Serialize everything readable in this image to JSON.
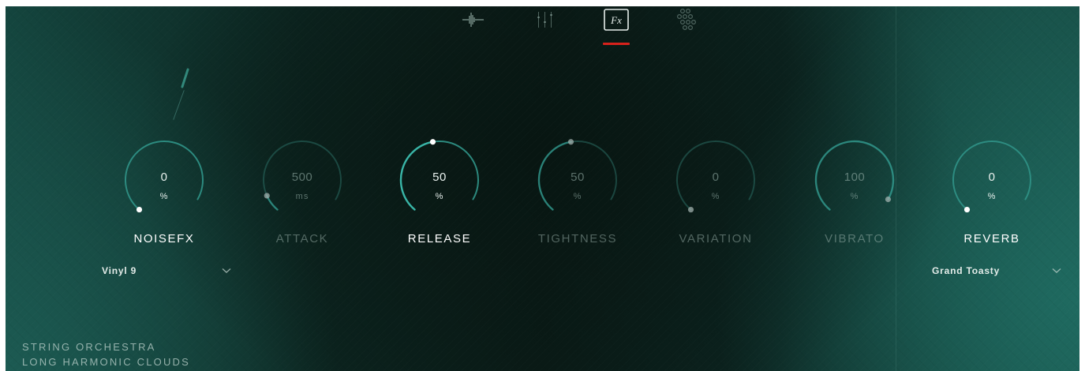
{
  "nav": {
    "tabs": [
      {
        "id": "waveform",
        "icon": "waveform-icon",
        "active": false
      },
      {
        "id": "mixer",
        "icon": "mixer-sliders-icon",
        "active": false
      },
      {
        "id": "fx",
        "icon": "fx-icon",
        "label": "Fx",
        "active": true
      },
      {
        "id": "grid",
        "icon": "dot-grid-icon",
        "active": false
      }
    ],
    "active_indicator_color": "#d7221c"
  },
  "knobs": [
    {
      "name": "noisefx",
      "label": "NOISEFX",
      "value": "0",
      "unit": "%",
      "active": true,
      "level": 0.0
    },
    {
      "name": "attack",
      "label": "ATTACK",
      "value": "500",
      "unit": "ms",
      "active": false,
      "level": 0.1
    },
    {
      "name": "release",
      "label": "RELEASE",
      "value": "50",
      "unit": "%",
      "active": true,
      "level": 0.5
    },
    {
      "name": "tightness",
      "label": "TIGHTNESS",
      "value": "50",
      "unit": "%",
      "active": false,
      "level": 0.5
    },
    {
      "name": "variation",
      "label": "VARIATION",
      "value": "0",
      "unit": "%",
      "active": false,
      "level": 0.0
    },
    {
      "name": "vibrato",
      "label": "VIBRATO",
      "value": "100",
      "unit": "%",
      "active": false,
      "level": 1.0
    },
    {
      "name": "reverb",
      "label": "REVERB",
      "value": "0",
      "unit": "%",
      "active": true,
      "level": 0.0
    }
  ],
  "noisefx_preset": {
    "selected": "Vinyl 9"
  },
  "reverb_preset": {
    "selected": "Grand Toasty"
  },
  "instrument": {
    "line1": "STRING ORCHESTRA",
    "line2": "LONG HARMONIC CLOUDS"
  },
  "colors": {
    "accent": "#39b5a7",
    "track_active": "#2e8f84",
    "track_inactive": "#2a6b62"
  }
}
